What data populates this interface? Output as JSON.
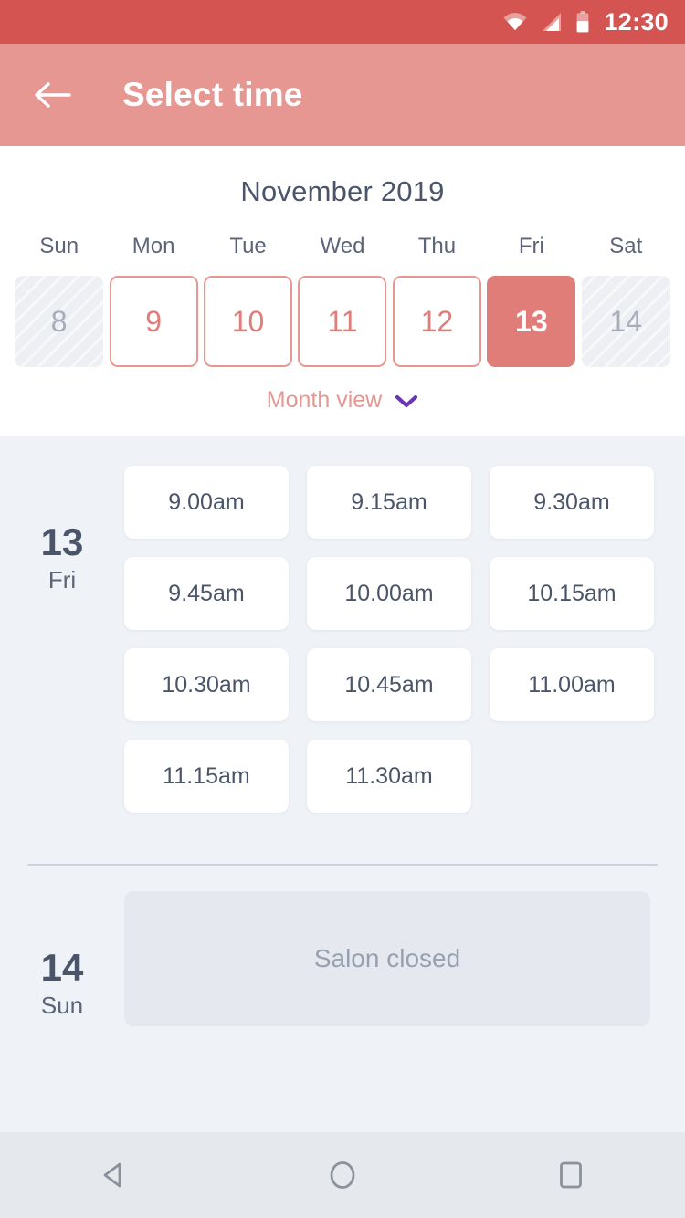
{
  "status_bar": {
    "time": "12:30",
    "icons": [
      "wifi-icon",
      "cell-signal-icon",
      "battery-icon"
    ],
    "background_color": "#d35450"
  },
  "app_bar": {
    "title": "Select time",
    "back_icon": "back-arrow-icon",
    "background_color": "#e79792",
    "text_color": "#ffffff"
  },
  "calendar": {
    "month_label": "November 2019",
    "weekdays": [
      "Sun",
      "Mon",
      "Tue",
      "Wed",
      "Thu",
      "Fri",
      "Sat"
    ],
    "days": [
      {
        "num": "8",
        "state": "disabled"
      },
      {
        "num": "9",
        "state": "available"
      },
      {
        "num": "10",
        "state": "available"
      },
      {
        "num": "11",
        "state": "available"
      },
      {
        "num": "12",
        "state": "available"
      },
      {
        "num": "13",
        "state": "selected"
      },
      {
        "num": "14",
        "state": "disabled"
      }
    ],
    "view_toggle_label": "Month view",
    "view_toggle_icon": "chevron-down-icon",
    "accent_color": "#e07d78",
    "toggle_chevron_color": "#6a35b5"
  },
  "schedule": [
    {
      "day_number": "13",
      "day_name": "Fri",
      "slots": [
        "9.00am",
        "9.15am",
        "9.30am",
        "9.45am",
        "10.00am",
        "10.15am",
        "10.30am",
        "10.45am",
        "11.00am",
        "11.15am",
        "11.30am"
      ]
    },
    {
      "day_number": "14",
      "day_name": "Sun",
      "closed_message": "Salon closed"
    }
  ],
  "nav_bar": {
    "buttons": [
      "back-nav-icon",
      "home-nav-icon",
      "recents-nav-icon"
    ],
    "background_color": "#e5e8ed"
  }
}
